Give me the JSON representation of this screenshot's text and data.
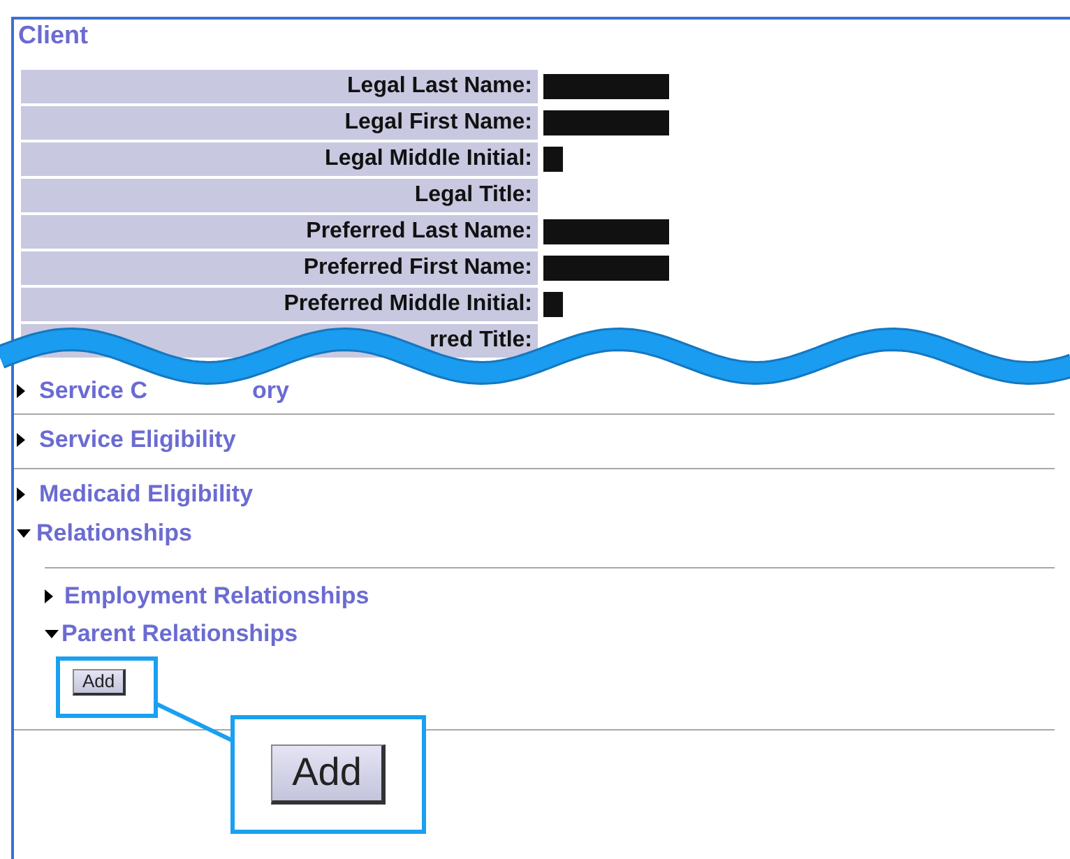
{
  "panel": {
    "title": "Client"
  },
  "fields": [
    {
      "label": "Legal Last Name:",
      "redacted": true,
      "initial": false
    },
    {
      "label": "Legal First Name:",
      "redacted": true,
      "initial": false
    },
    {
      "label": "Legal Middle Initial:",
      "redacted": true,
      "initial": true
    },
    {
      "label": "Legal Title:",
      "redacted": false
    },
    {
      "label": "Preferred Last Name:",
      "redacted": true,
      "initial": false
    },
    {
      "label": "Preferred First Name:",
      "redacted": true,
      "initial": false
    },
    {
      "label": "Preferred Middle Initial:",
      "redacted": true,
      "initial": true
    },
    {
      "label": "rred Title:",
      "redacted": false
    }
  ],
  "sections": [
    {
      "fragments": [
        "Service C",
        "ory"
      ],
      "expanded": false
    },
    {
      "fragments": [
        "Service Eligibility"
      ],
      "expanded": false
    },
    {
      "fragments": [
        "Medicaid Eligibility"
      ],
      "expanded": false
    },
    {
      "fragments": [
        "Relationships"
      ],
      "expanded": true,
      "children": [
        {
          "title": "Employment Relationships",
          "expanded": false
        },
        {
          "title": "Parent Relationships",
          "expanded": true,
          "button": "Add"
        }
      ]
    }
  ],
  "callout": {
    "label": "Add"
  }
}
